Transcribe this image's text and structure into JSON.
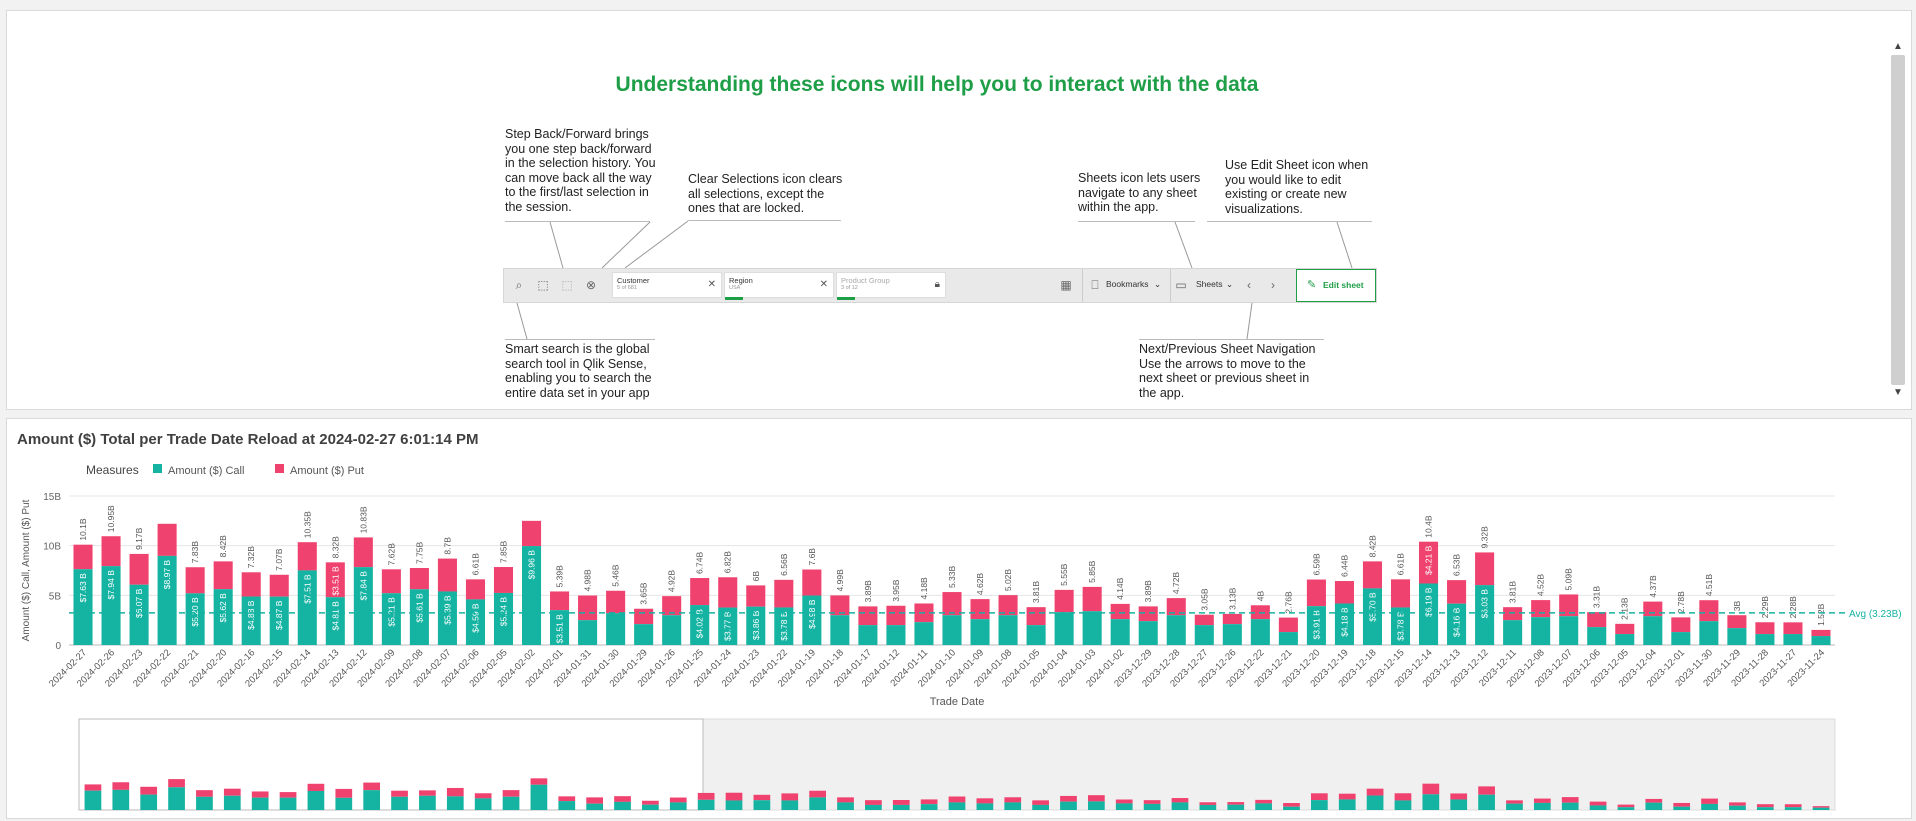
{
  "help": {
    "title": "Understanding these icons will help you to interact with the data",
    "notes": {
      "step": [
        "Step Back/Forward brings",
        "you one step back/forward",
        "in the selection history. You",
        "can move back all the way",
        "to the first/last selection in",
        "the session."
      ],
      "clear": [
        "Clear Selections icon clears",
        "all selections, except the",
        "ones that are locked."
      ],
      "sheets": [
        "Sheets icon lets users",
        "navigate to any sheet",
        "within the app."
      ],
      "edit": [
        "Use Edit Sheet icon when",
        "you would like to edit",
        "existing or create new",
        "visualizations."
      ],
      "search": [
        "Smart search is the global",
        "search tool in Qlik Sense,",
        "enabling you to search the",
        "entire data set in your app"
      ],
      "nav": [
        "Next/Previous Sheet Navigation",
        "Use the arrows to move to the",
        "next sheet or previous sheet in",
        "the app."
      ]
    },
    "toolbar": {
      "fields": [
        {
          "label": "Customer",
          "sub": "5 of 681"
        },
        {
          "label": "Region",
          "sub": "USA"
        },
        {
          "label": "Product Group",
          "sub": "3 of 12"
        }
      ],
      "bookmarks": "Bookmarks",
      "sheets": "Sheets",
      "edit": "Edit sheet"
    }
  },
  "chart": {
    "title": "Amount ($) Total per Trade Date Reload at 2024-02-27 6:01:14 PM",
    "legend_title": "Measures",
    "avg_label": "Avg (3.23B)"
  },
  "colors": {
    "call": "#15b3a2",
    "put": "#f0426e",
    "title_green": "#1e9e47"
  },
  "chart_data": {
    "type": "bar",
    "stacked": true,
    "xlabel": "Trade Date",
    "ylabel": "Amount ($) Call, Amount ($) Put",
    "yticks": [
      "0",
      "5B",
      "10B",
      "15B"
    ],
    "ylim": [
      0,
      15
    ],
    "reference_line": {
      "label": "Avg (3.23B)",
      "value": 3.23
    },
    "categories": [
      "2024-02-27",
      "2024-02-26",
      "2024-02-23",
      "2024-02-22",
      "2024-02-21",
      "2024-02-20",
      "2024-02-16",
      "2024-02-15",
      "2024-02-14",
      "2024-02-13",
      "2024-02-12",
      "2024-02-09",
      "2024-02-08",
      "2024-02-07",
      "2024-02-06",
      "2024-02-05",
      "2024-02-02",
      "2024-02-01",
      "2024-01-31",
      "2024-01-30",
      "2024-01-29",
      "2024-01-26",
      "2024-01-25",
      "2024-01-24",
      "2024-01-23",
      "2024-01-22",
      "2024-01-19",
      "2024-01-18",
      "2024-01-17",
      "2024-01-12",
      "2024-01-11",
      "2024-01-10",
      "2024-01-09",
      "2024-01-08",
      "2024-01-05",
      "2024-01-04",
      "2024-01-03",
      "2024-01-02",
      "2023-12-29",
      "2023-12-28",
      "2023-12-27",
      "2023-12-26",
      "2023-12-22",
      "2023-12-21",
      "2023-12-20",
      "2023-12-19",
      "2023-12-18",
      "2023-12-15",
      "2023-12-14",
      "2023-12-13",
      "2023-12-12",
      "2023-12-11",
      "2023-12-08",
      "2023-12-07",
      "2023-12-06",
      "2023-12-05",
      "2023-12-04",
      "2023-12-01",
      "2023-11-30",
      "2023-11-29",
      "2023-11-28",
      "2023-11-27",
      "2023-11-24"
    ],
    "totals": [
      10.1,
      10.95,
      9.17,
      12.2,
      7.83,
      8.42,
      7.32,
      7.07,
      10.35,
      8.32,
      10.83,
      7.62,
      7.75,
      8.7,
      6.61,
      7.85,
      12.5,
      5.39,
      4.98,
      5.46,
      3.65,
      4.92,
      6.74,
      6.82,
      6,
      6.56,
      7.6,
      4.99,
      3.89,
      3.95,
      4.18,
      5.33,
      4.62,
      5.02,
      3.81,
      5.55,
      5.85,
      4.14,
      3.89,
      4.72,
      3.05,
      3.13,
      4,
      2.76,
      6.59,
      6.44,
      8.42,
      6.61,
      10.4,
      6.53,
      9.32,
      3.81,
      4.52,
      5.09,
      3.31,
      2.13,
      4.37,
      2.78,
      4.51,
      3,
      2.29,
      2.28,
      1.52
    ],
    "total_labels": [
      "10.1B",
      "10.95B",
      "9.17B",
      "",
      "7.83B",
      "8.42B",
      "7.32B",
      "7.07B",
      "10.35B",
      "8.32B",
      "10.83B",
      "7.62B",
      "7.75B",
      "8.7B",
      "6.61B",
      "7.85B",
      "",
      "5.39B",
      "4.98B",
      "5.46B",
      "3.65B",
      "4.92B",
      "6.74B",
      "6.82B",
      "6B",
      "6.56B",
      "7.6B",
      "4.99B",
      "3.89B",
      "3.95B",
      "4.18B",
      "5.33B",
      "4.62B",
      "5.02B",
      "3.81B",
      "5.55B",
      "5.85B",
      "4.14B",
      "3.89B",
      "4.72B",
      "3.05B",
      "3.13B",
      "4B",
      "2.76B",
      "6.59B",
      "6.44B",
      "8.42B",
      "6.61B",
      "10.4B",
      "6.53B",
      "9.32B",
      "3.81B",
      "4.52B",
      "5.09B",
      "3.31B",
      "2.13B",
      "4.37B",
      "2.78B",
      "4.51B",
      "3B",
      "2.29B",
      "2.28B",
      "1.52B"
    ],
    "series": [
      {
        "name": "Amount ($) Call",
        "values": [
          7.63,
          7.94,
          6.07,
          8.97,
          5.2,
          5.62,
          4.88,
          4.87,
          7.51,
          4.81,
          7.84,
          5.21,
          5.61,
          5.39,
          4.59,
          5.24,
          9.96,
          3.51,
          2.5,
          3.2,
          2.1,
          3,
          4.02,
          3.77,
          3.86,
          3.78,
          4.98,
          3,
          2,
          2,
          2.3,
          3,
          2.6,
          3,
          2,
          3.3,
          3.4,
          2.6,
          2.4,
          3,
          2,
          2.1,
          2.6,
          1.3,
          3.91,
          4.18,
          5.7,
          3.78,
          6.19,
          4.16,
          6.03,
          2.5,
          2.8,
          2.9,
          1.8,
          1.1,
          2.9,
          1.3,
          2.4,
          1.7,
          1.1,
          1.1,
          0.9
        ],
        "value_labels": [
          "$7.63 B",
          "$7.94 B",
          "$6.07 B",
          "$8.97 B",
          "$5.20 B",
          "$5.62 B",
          "$4.88 B",
          "$4.87 B",
          "$7.51 B",
          "$4.81 B",
          "$7.84 B",
          "$5.21 B",
          "$5.61 B",
          "$5.39 B",
          "$4.59 B",
          "$5.24 B",
          "$9.96 B",
          "$3.51 B",
          "",
          "",
          "",
          "",
          "$4.02 B",
          "$3.77 B",
          "$3.86 B",
          "$3.78 B",
          "$4.98 B",
          "",
          "",
          "",
          "",
          "",
          "",
          "",
          "",
          "",
          "",
          "",
          "",
          "",
          "",
          "",
          "",
          "",
          "$3.91 B",
          "$4.18 B",
          "$5.70 B",
          "$3.78 B",
          "$6.19 B",
          "$4.16 B",
          "$6.03 B",
          "",
          "",
          "",
          "",
          "",
          "",
          "",
          "",
          "",
          "",
          "",
          ""
        ]
      },
      {
        "name": "Amount ($) Put",
        "value_labels": [
          "",
          "",
          "",
          "",
          "",
          "",
          "",
          "",
          "",
          "$3.51 B",
          "",
          "",
          "",
          "",
          "",
          "",
          "",
          "",
          "",
          "",
          "",
          "",
          "",
          "",
          "",
          "",
          "",
          "",
          "",
          "",
          "",
          "",
          "",
          "",
          "",
          "",
          "",
          "",
          "",
          "",
          "",
          "",
          "",
          "",
          "",
          "",
          "",
          "",
          "$4.21 B",
          "",
          "",
          "",
          "",
          "",
          "",
          "",
          "",
          "",
          "",
          "",
          "",
          "",
          ""
        ]
      }
    ]
  }
}
